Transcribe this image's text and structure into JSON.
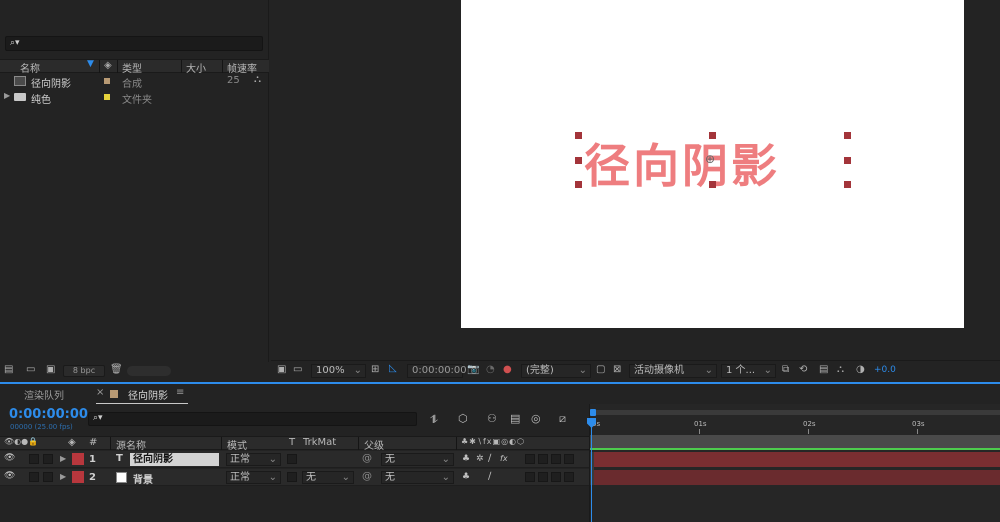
{
  "project": {
    "search_placeholder": "⌕▾",
    "columns": {
      "name": "名称",
      "type": "类型",
      "size": "大小",
      "fps": "帧速率"
    },
    "items": [
      {
        "name": "径向阴影",
        "type": "合成",
        "fps": "25",
        "swatch": "#b89a74"
      },
      {
        "name": "纯色",
        "type": "文件夹",
        "fps": "",
        "swatch": "#e6d23c"
      }
    ],
    "bpc_label": "8 bpc"
  },
  "viewer": {
    "canvas_text": "径向阴影",
    "text_color": "#ee7d7f",
    "handle_color": "#a3343a",
    "zoom": "100%",
    "timecode": "0:00:00:00",
    "resolution": "(完整)",
    "camera": "活动摄像机",
    "views": "1 个...",
    "exposure": "+0.0"
  },
  "timeline": {
    "tabs": {
      "render_queue": "渲染队列",
      "comp_tab": "径向阴影",
      "close": "×",
      "menu": "≡"
    },
    "timecode": "0:00:00:00",
    "timecode_sub": "00000 (25.00 fps)",
    "search_placeholder": "⌕▾",
    "headers": {
      "num": "#",
      "source": "源名称",
      "mode": "模式",
      "t": "T",
      "trkmat": "TrkMat",
      "parent": "父级"
    },
    "layers": [
      {
        "num": "1",
        "type": "T",
        "name": "径向阴影",
        "mode": "正常",
        "trkmat": "",
        "parent": "无",
        "label_color": "#b8373d"
      },
      {
        "num": "2",
        "type": "",
        "name": "背景",
        "mode": "正常",
        "trkmat": "无",
        "parent": "无",
        "label_color": "#b8373d"
      }
    ],
    "ruler": [
      "0s",
      "01s",
      "02s",
      "03s"
    ],
    "bar_color": "#7a2e31",
    "accent": "#2d8ceb"
  }
}
